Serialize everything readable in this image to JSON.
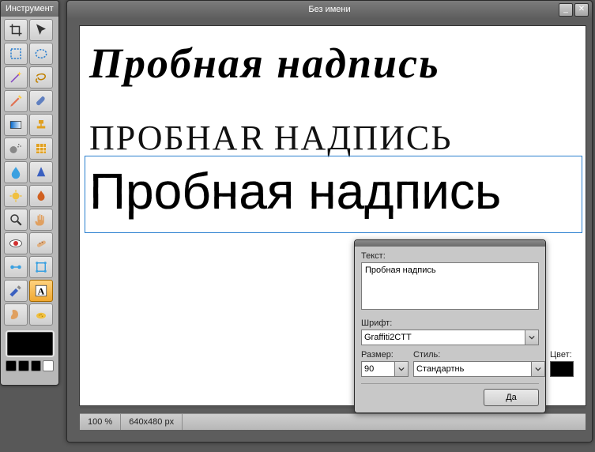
{
  "toolWindow": {
    "title": "Инструмент"
  },
  "docWindow": {
    "title": "Без имени",
    "minimize": "_",
    "close": "✕"
  },
  "canvas": {
    "line1": "Пробная  надпись",
    "line2_part1": "ПРОБНА",
    "line2_flip": "Я",
    "line2_part2": " НАДПИСЬ",
    "line3": "Пробная надпись"
  },
  "status": {
    "zoom": "100 %",
    "dims": "640x480 px"
  },
  "dialog": {
    "textLabel": "Текст:",
    "textValue": "Пробная надпись",
    "fontLabel": "Шрифт:",
    "fontValue": "Graffiti2CTT",
    "sizeLabel": "Размер:",
    "sizeValue": "90",
    "styleLabel": "Стиль:",
    "styleValue": "Стандартнь",
    "colorLabel": "Цвет:",
    "colorValue": "#000000",
    "ok": "Да"
  },
  "tools": [
    "crop",
    "pointer",
    "rect-select",
    "ellipse-select",
    "wand",
    "lasso",
    "pencil",
    "brush",
    "gradient",
    "stamp",
    "spray",
    "pattern",
    "blur",
    "sharpen",
    "dodge",
    "burn",
    "zoom",
    "hand",
    "red-eye",
    "heal",
    "align",
    "shape",
    "eyedropper",
    "text",
    "smudge",
    "sponge"
  ],
  "selectedTool": "text"
}
